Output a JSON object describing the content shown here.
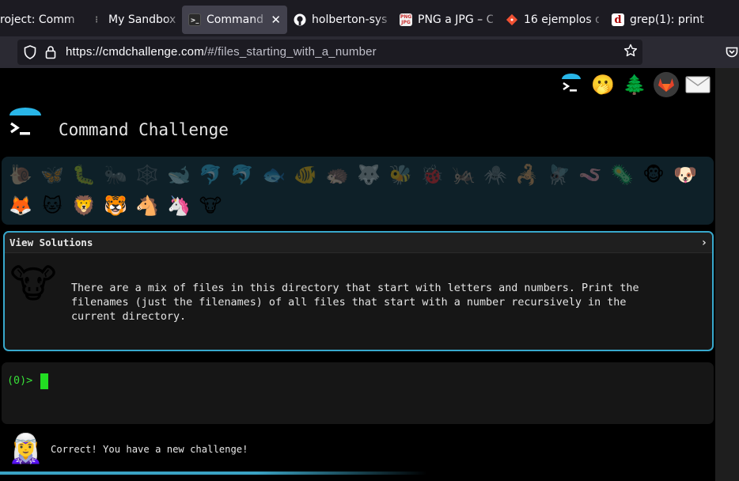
{
  "browser": {
    "tabs": [
      {
        "label": "roject: Comm",
        "favicon": "document-icon",
        "active": false
      },
      {
        "label": "My Sandboxes",
        "favicon": "sandbox-icon",
        "active": false
      },
      {
        "label": "Command C",
        "favicon": "terminal-icon",
        "active": true
      },
      {
        "label": "holberton-syst",
        "favicon": "github-icon",
        "active": false
      },
      {
        "label": "PNG a JPG – C",
        "favicon": "png-jpg-icon",
        "active": false
      },
      {
        "label": "16 ejemplos d",
        "favicon": "git-icon",
        "active": false
      },
      {
        "label": "grep(1): print",
        "favicon": "d-icon",
        "active": false
      }
    ],
    "url": {
      "host": "https://cmdchallenge.com",
      "path": "/#/files_starting_with_a_number"
    }
  },
  "header": {
    "title": "Command Challenge",
    "icons": [
      "cmdchallenge-logo-icon",
      "thinking-face-icon",
      "tree-icon",
      "gitlab-icon",
      "envelope-icon"
    ]
  },
  "challenges": [
    {
      "icon": "snail",
      "done": true
    },
    {
      "icon": "butterfly",
      "done": true
    },
    {
      "icon": "caterpillar",
      "done": true
    },
    {
      "icon": "ant",
      "done": true
    },
    {
      "icon": "spider-web",
      "done": true
    },
    {
      "icon": "whale",
      "done": true
    },
    {
      "icon": "dolphin",
      "done": true
    },
    {
      "icon": "dolphin-2",
      "done": true
    },
    {
      "icon": "fish",
      "done": true
    },
    {
      "icon": "tropical-fish",
      "done": true
    },
    {
      "icon": "hedgehog",
      "done": true
    },
    {
      "icon": "wolf",
      "done": true
    },
    {
      "icon": "bee",
      "done": true
    },
    {
      "icon": "ladybug",
      "done": true
    },
    {
      "icon": "cricket",
      "done": true
    },
    {
      "icon": "spider",
      "done": true
    },
    {
      "icon": "scorpion",
      "done": true
    },
    {
      "icon": "fly",
      "done": true
    },
    {
      "icon": "worm",
      "done": true
    },
    {
      "icon": "microbe",
      "done": true
    },
    {
      "icon": "monkey",
      "done": false
    },
    {
      "icon": "dog",
      "done": false
    },
    {
      "icon": "fox",
      "done": false
    },
    {
      "icon": "cat",
      "done": false
    },
    {
      "icon": "lion",
      "done": false
    },
    {
      "icon": "tiger",
      "done": false
    },
    {
      "icon": "horse",
      "done": false
    },
    {
      "icon": "unicorn",
      "done": false
    },
    {
      "icon": "cow",
      "done": false
    }
  ],
  "challenge_card": {
    "toggle_label": "View Solutions",
    "icon": "cow-face-icon",
    "description": "There are a mix of files in this directory that start with letters and numbers. Print the\nfilenames (just the filenames) of all files that start with a number recursively in the\ncurrent directory."
  },
  "terminal": {
    "prompt": "(0)>"
  },
  "result": {
    "icon": "elf-icon",
    "message": "Correct! You have a new challenge!"
  },
  "colors": {
    "accent": "#38a8cc",
    "prompt_green": "#38e038",
    "strip_bg": "#0e2028"
  }
}
